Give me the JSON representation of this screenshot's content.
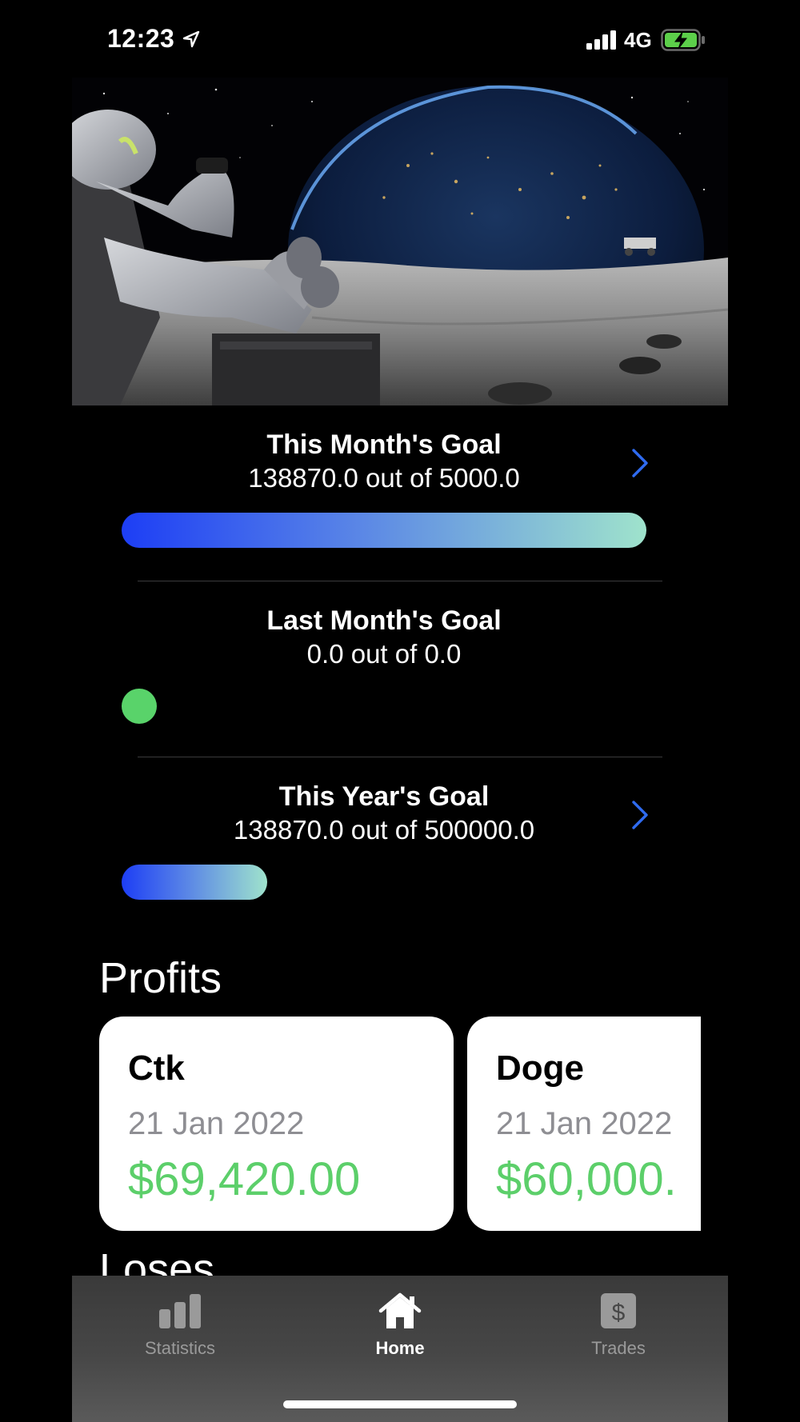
{
  "status_bar": {
    "time": "12:23",
    "network": "4G",
    "location_icon": "location-arrow-icon",
    "signal_icon": "cellular-signal-icon",
    "battery_icon": "battery-charging-icon"
  },
  "hero": {
    "image": "astronaut-on-moon-illustration"
  },
  "goals": [
    {
      "title": "This Month's Goal",
      "subtitle": "138870.0 out of 5000.0",
      "progress": 1.0,
      "has_chevron": true
    },
    {
      "title": "Last Month's Goal",
      "subtitle": "0.0 out of 0.0",
      "progress": 0.0,
      "has_chevron": false
    },
    {
      "title": "This Year's Goal",
      "subtitle": "138870.0 out of 500000.0",
      "progress": 0.2777,
      "has_chevron": true
    }
  ],
  "profits": {
    "title": "Profits",
    "cards": [
      {
        "name": "Ctk",
        "date": "21 Jan 2022",
        "amount": "$69,420.00"
      },
      {
        "name": "Doge",
        "date": "21 Jan 2022",
        "amount": "$60,000."
      }
    ]
  },
  "loses": {
    "title": "Loses"
  },
  "tab_bar": {
    "tabs": [
      {
        "label": "Statistics",
        "icon": "bar-chart-icon",
        "active": false
      },
      {
        "label": "Home",
        "icon": "house-icon",
        "active": true
      },
      {
        "label": "Trades",
        "icon": "dollar-sign-icon",
        "active": false
      }
    ]
  },
  "colors": {
    "accent_blue": "#2f6bf0",
    "profit_green": "#5ccf6a",
    "gradient_start": "#1d3ef5",
    "gradient_end": "#9fe3cc"
  }
}
